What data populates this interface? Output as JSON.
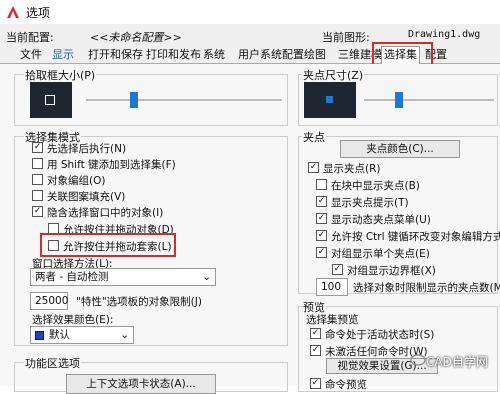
{
  "window": {
    "title": "选项"
  },
  "config": {
    "current_config_label": "当前配置:",
    "current_config_value": "<<未命名配置>>",
    "current_drawing_label": "当前图形:",
    "current_drawing_value": "Drawing1.dwg"
  },
  "tabs": [
    "文件",
    "显示",
    "打开和保存",
    "打印和发布",
    "系统",
    "用户系统配置",
    "绘图",
    "三维建模",
    "选择集",
    "配置"
  ],
  "left": {
    "pickbox_label": "拾取框大小(P)",
    "selection_modes_label": "选择集模式",
    "modes": [
      {
        "label": "先选择后执行(N)",
        "checked": true
      },
      {
        "label": "用 Shift 键添加到选择集(F)",
        "checked": false
      },
      {
        "label": "对象编组(O)",
        "checked": false
      },
      {
        "label": "关联图案填充(V)",
        "checked": false
      },
      {
        "label": "隐含选择窗口中的对象(I)",
        "checked": true
      },
      {
        "label": "允许按住并拖动对象(D)",
        "checked": false
      },
      {
        "label": "允许按住并拖动套索(L)",
        "checked": false
      }
    ],
    "window_method_label": "窗口选择方法(L):",
    "window_method_value": "两者 - 自动检测",
    "limit_value": "25000",
    "limit_label": "\"特性\"选项板的对象限制(J)",
    "effect_color_label": "选择效果颜色(E):",
    "effect_color_value": "默认",
    "ribbon_label": "功能区选项",
    "ribbon_button": "上下文选项卡状态(A)..."
  },
  "right": {
    "gripsize_label": "夹点尺寸(Z)",
    "grips_label": "夹点",
    "grip_color_button": "夹点颜色(C)...",
    "grips": [
      {
        "label": "显示夹点(R)",
        "checked": true
      },
      {
        "label": "在块中显示夹点(B)",
        "checked": false
      },
      {
        "label": "显示夹点提示(T)",
        "checked": true
      },
      {
        "label": "显示动态夹点菜单(U)",
        "checked": true
      },
      {
        "label": "允许按 Ctrl 键循环改变对象编辑方式",
        "checked": true
      },
      {
        "label": "对组显示单个夹点(E)",
        "checked": true
      },
      {
        "label": "对组显示边界框(X)",
        "checked": true
      }
    ],
    "grip_limit_value": "100",
    "grip_limit_label": "选择对象时限制显示的夹点数(M)",
    "preview_label": "预览",
    "sel_preview_label": "选择集预览",
    "preview_items": [
      {
        "label": "命令处于活动状态时(S)",
        "checked": true
      },
      {
        "label": "未激活任何命令时(W)",
        "checked": true
      }
    ],
    "visual_button": "视觉效果设置(G)...",
    "last_item": "命令预览"
  },
  "watermark": "CAD自学网",
  "colors": {
    "accent": "#1e77d3",
    "highlight": "#d62b2b"
  }
}
